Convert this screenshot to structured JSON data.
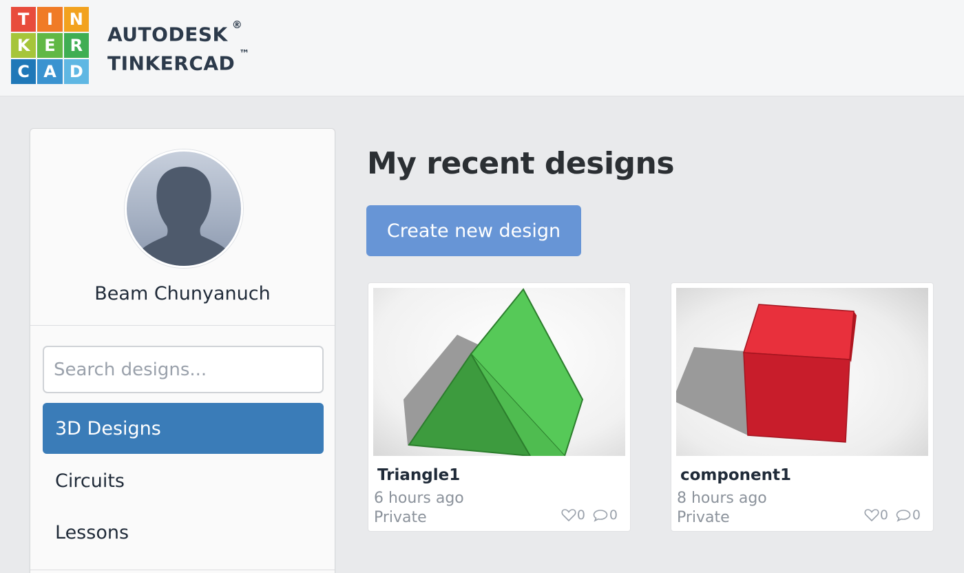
{
  "logo": {
    "letters": [
      "T",
      "I",
      "N",
      "K",
      "E",
      "R",
      "C",
      "A",
      "D"
    ],
    "colors": [
      "#e84c3c",
      "#f07b26",
      "#f2a21f",
      "#a6c53a",
      "#61b845",
      "#3fae53",
      "#1f78b8",
      "#3a93d0",
      "#5fb7e3"
    ]
  },
  "brand": {
    "line1": "AUTODESK",
    "line1_mark": "®",
    "line2": "TINKERCAD",
    "line2_mark": "™"
  },
  "sidebar": {
    "user_name": "Beam Chunyanuch",
    "avatar_icon": "user-silhouette-icon",
    "search": {
      "placeholder": "Search designs...",
      "value": ""
    },
    "nav": [
      {
        "label": "3D Designs",
        "active": true
      },
      {
        "label": "Circuits",
        "active": false
      },
      {
        "label": "Lessons",
        "active": false
      }
    ]
  },
  "main": {
    "title": "My recent designs",
    "create_button": "Create new design",
    "designs": [
      {
        "name": "Triangle1",
        "time": "6 hours ago",
        "privacy": "Private",
        "likes": "0",
        "comments": "0",
        "shape": "green-pyramid"
      },
      {
        "name": "component1",
        "time": "8 hours ago",
        "privacy": "Private",
        "likes": "0",
        "comments": "0",
        "shape": "red-cube"
      }
    ]
  },
  "colors": {
    "accent_active_nav": "#3a7cb8",
    "create_button": "#6795d6",
    "pyramid_green": "#52c254",
    "cube_red": "#d8202c"
  }
}
